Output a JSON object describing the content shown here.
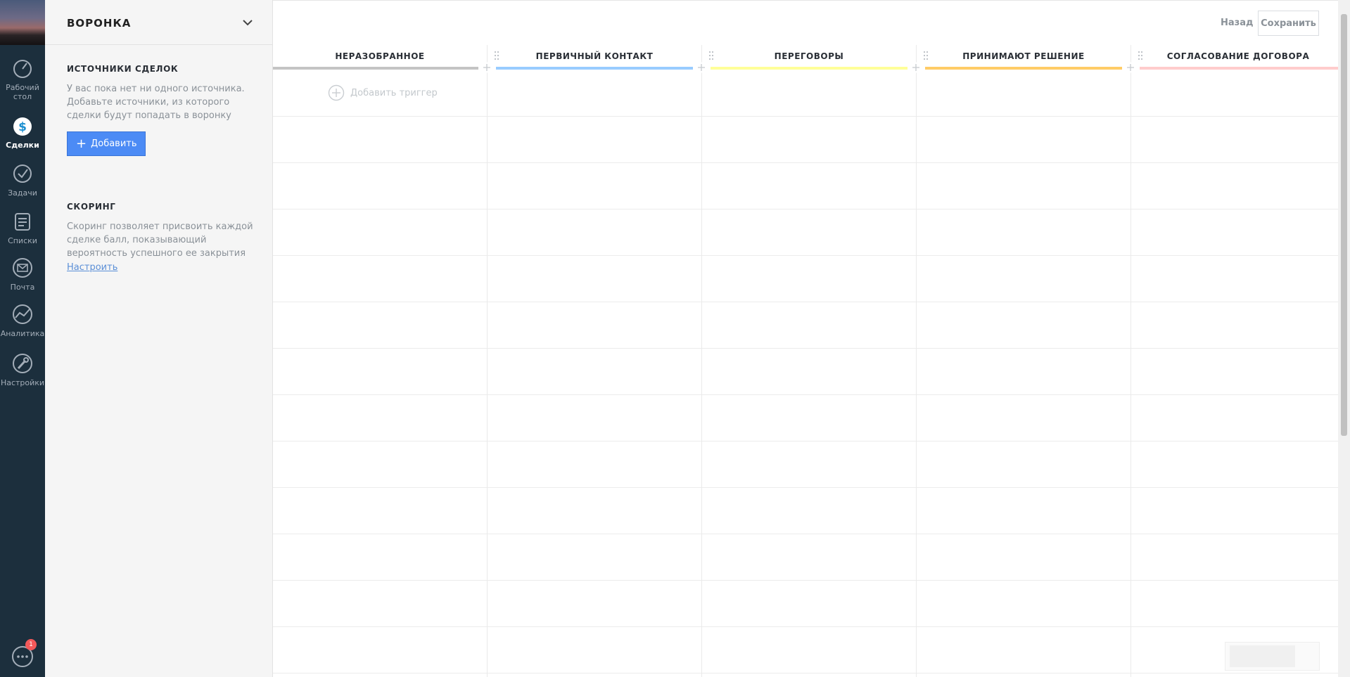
{
  "nav": {
    "items": [
      {
        "label": "Рабочий стол",
        "icon": "dashboard-icon"
      },
      {
        "label": "Сделки",
        "icon": "deals-icon",
        "active": true
      },
      {
        "label": "Задачи",
        "icon": "tasks-icon"
      },
      {
        "label": "Списки",
        "icon": "lists-icon"
      },
      {
        "label": "Почта",
        "icon": "mail-icon"
      },
      {
        "label": "Аналитика",
        "icon": "analytics-icon"
      },
      {
        "label": "Настройки",
        "icon": "settings-icon"
      }
    ],
    "chat_badge": "1"
  },
  "panel": {
    "title": "ВОРОНКА",
    "sources": {
      "title": "ИСТОЧНИКИ СДЕЛОК",
      "text": "У вас пока нет ни одного источника. Добавьте источники, из которого сделки будут попадать в воронку",
      "add_label": "Добавить"
    },
    "scoring": {
      "title": "СКОРИНГ",
      "text": "Скоринг позволяет присвоить каждой сделке балл, показывающий вероятность успешного ее закрытия",
      "link_label": "Настроить"
    }
  },
  "topbar": {
    "back_label": "Назад",
    "save_label": "Сохранить"
  },
  "board": {
    "columns": [
      {
        "name": "НЕРАЗОБРАННОЕ",
        "color": "#c4c4c4"
      },
      {
        "name": "ПЕРВИЧНЫЙ КОНТАКТ",
        "color": "#99ccff"
      },
      {
        "name": "ПЕРЕГОВОРЫ",
        "color": "#ffff99"
      },
      {
        "name": "ПРИНИМАЮТ РЕШЕНИЕ",
        "color": "#ffcc66"
      },
      {
        "name": "СОГЛАСОВАНИЕ ДОГОВОРА",
        "color": "#ffcccc"
      }
    ],
    "trigger_label": "Добавить триггер"
  }
}
